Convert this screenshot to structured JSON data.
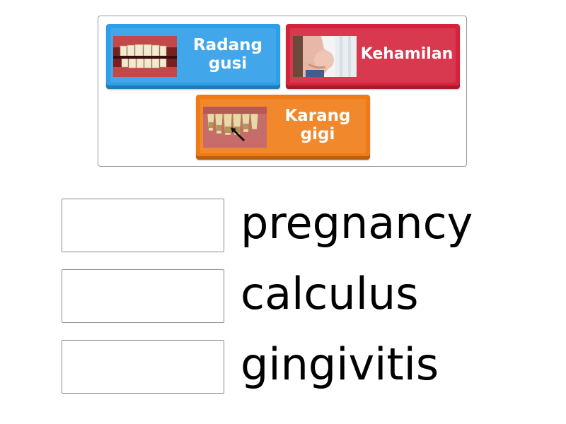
{
  "tiles": [
    {
      "id": "radang-gusi",
      "label": "Radang gusi",
      "color": "#2d9ee8",
      "image": "inflamed-gums-photo"
    },
    {
      "id": "kehamilan",
      "label": "Kehamilan",
      "color": "#d4233a",
      "image": "pregnant-woman-photo"
    },
    {
      "id": "karang-gigi",
      "label": "Karang gigi",
      "color": "#f07b14",
      "image": "dental-calculus-photo"
    }
  ],
  "targets": [
    {
      "word": "pregnancy",
      "answer": ""
    },
    {
      "word": "calculus",
      "answer": ""
    },
    {
      "word": "gingivitis",
      "answer": ""
    }
  ]
}
